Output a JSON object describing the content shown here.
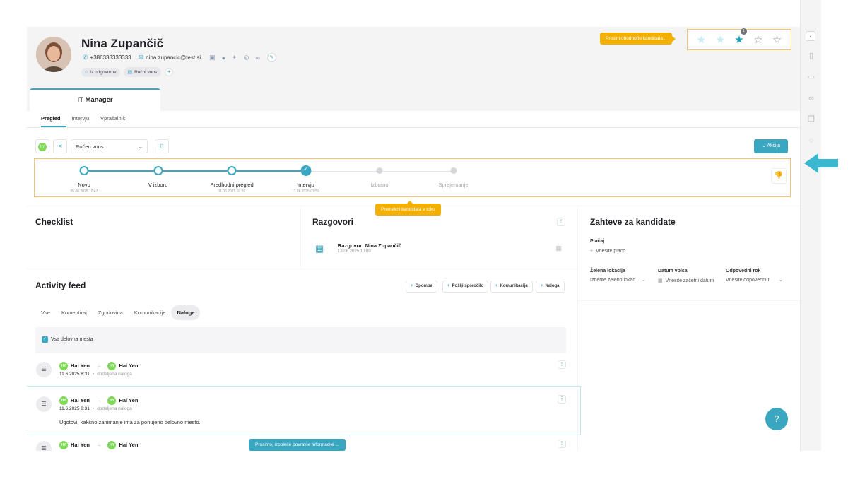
{
  "candidate": {
    "name": "Nina Zupančič",
    "phone": "+386333333333",
    "email": "nina.zupancic@test.si",
    "tags": [
      "Iz odgovorov",
      "Ročni vnos"
    ]
  },
  "rating": {
    "tooltip": "Prosim ohodnofte kandidata...",
    "stars_total": 5,
    "stars_filled": 3,
    "badge_count": "1"
  },
  "job_tab": "IT Manager",
  "subtabs": [
    "Pregled",
    "Intervju",
    "Vprašalnik"
  ],
  "toolbar": {
    "avatar_initials": "HY",
    "source_select": "Ročen vnos",
    "action_label": "Akcija"
  },
  "pipeline": {
    "stages": [
      {
        "label": "Novo",
        "date": "05.06.2025 10:47",
        "state": "active"
      },
      {
        "label": "V izboru",
        "date": "",
        "state": "active"
      },
      {
        "label": "Predhodni pregled",
        "date": "11.06.2025 07:59",
        "state": "active"
      },
      {
        "label": "Intervju",
        "date": "11.06.2025 07:59",
        "state": "current"
      },
      {
        "label": "Izbrano",
        "date": "",
        "state": "todo"
      },
      {
        "label": "Sprejemanje",
        "date": "",
        "state": "todo"
      }
    ],
    "move_tooltip": "Premakni kandidata v toku"
  },
  "checklist": {
    "title": "Checklist"
  },
  "conversations": {
    "title": "Razgovori",
    "item_title": "Razgovor: Nina Zupančič",
    "item_date": "13.06.2025 10:00"
  },
  "requirements": {
    "title": "Zahteve za kandidate",
    "salary_label": "Plačaj",
    "salary_placeholder": "Vnesite plačo",
    "location_label": "Želena lokacija",
    "location_placeholder": "Izberite želeno lokac",
    "start_label": "Datum vpisa",
    "start_placeholder": "Vnesite začetni datum",
    "deadline_label": "Odpovedni rok",
    "deadline_placeholder": "Vnesite odpovedni r"
  },
  "feed": {
    "title": "Activity feed",
    "buttons": [
      "Opomba",
      "Pošlji sporočilo",
      "Komunikacija",
      "Naloga"
    ],
    "tabs": [
      "Vse",
      "Komentiraj",
      "Zgodovina",
      "Komunikacije",
      "Naloge"
    ],
    "active_tab": "Naloge",
    "filter_label": "Vsa delovna mesta",
    "items": [
      {
        "from": "Hai Yen",
        "to": "Hai Yen",
        "date": "11.6.2025 8:31",
        "action": "dodeljena naloga",
        "text": ""
      },
      {
        "from": "Hai Yen",
        "to": "Hai Yen",
        "date": "11.6.2025 8:31",
        "action": "dodeljena naloga",
        "text": "Ugotovi, kakšno zanimanje ima za ponujeno delovno mesto."
      },
      {
        "from": "Hai Yen",
        "to": "Hai Yen",
        "date": "",
        "action": "",
        "text": ""
      }
    ],
    "feedback_tooltip": "Prosimo, izpolnite povratne informacije ..."
  },
  "help_label": "?",
  "colors": {
    "accent": "#3aa6bf",
    "warning": "#f4b000",
    "success_avatar": "#7ed957"
  }
}
